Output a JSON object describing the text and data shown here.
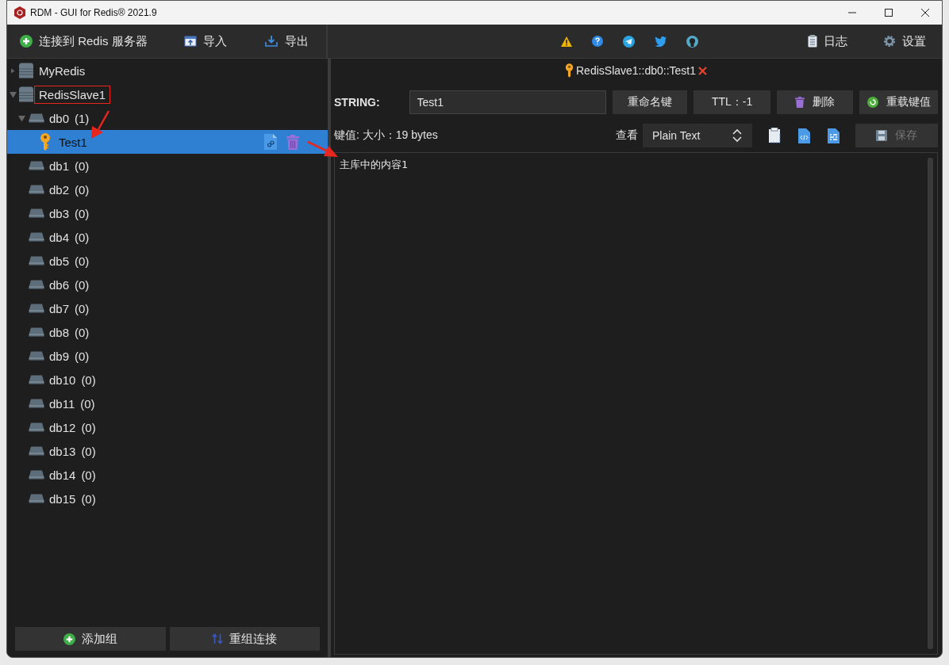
{
  "window": {
    "title": "RDM - GUI for Redis® 2021.9"
  },
  "toolbar": {
    "connect": "连接到 Redis 服务器",
    "import": "导入",
    "export": "导出",
    "log": "日志",
    "settings": "设置"
  },
  "tree": [
    {
      "name": "MyRedis",
      "expanded": false,
      "highlighted": false
    },
    {
      "name": "RedisSlave1",
      "expanded": true,
      "highlighted": true,
      "databases": [
        {
          "name": "db0",
          "count": "(1)",
          "expanded": true,
          "keys": [
            {
              "name": "Test1",
              "selected": true
            }
          ]
        },
        {
          "name": "db1",
          "count": "(0)"
        },
        {
          "name": "db2",
          "count": "(0)"
        },
        {
          "name": "db3",
          "count": "(0)"
        },
        {
          "name": "db4",
          "count": "(0)"
        },
        {
          "name": "db5",
          "count": "(0)"
        },
        {
          "name": "db6",
          "count": "(0)"
        },
        {
          "name": "db7",
          "count": "(0)"
        },
        {
          "name": "db8",
          "count": "(0)"
        },
        {
          "name": "db9",
          "count": "(0)"
        },
        {
          "name": "db10",
          "count": "(0)"
        },
        {
          "name": "db11",
          "count": "(0)"
        },
        {
          "name": "db12",
          "count": "(0)"
        },
        {
          "name": "db13",
          "count": "(0)"
        },
        {
          "name": "db14",
          "count": "(0)"
        },
        {
          "name": "db15",
          "count": "(0)"
        }
      ]
    }
  ],
  "sidebar_buttons": {
    "add_group": "添加组",
    "regroup": "重组连接"
  },
  "key_tab": {
    "title": "RedisSlave1::db0::Test1"
  },
  "key_editor": {
    "type": "STRING:",
    "key_name": "Test1",
    "rename": "重命名键",
    "ttl": "TTL：-1",
    "delete": "删除",
    "reload": "重载键值",
    "size": "键值: 大小：19 bytes",
    "view_label": "查看",
    "formatter": "Plain Text",
    "save": "保存",
    "save_disabled": true,
    "content": "主库中的内容1"
  }
}
